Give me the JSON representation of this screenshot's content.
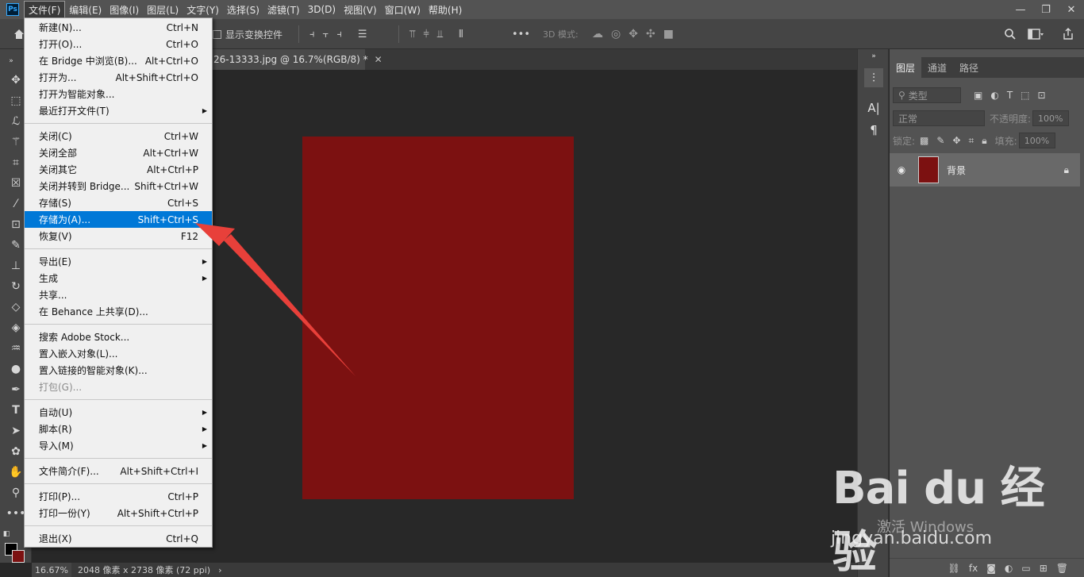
{
  "menubar": {
    "items": [
      "文件(F)",
      "编辑(E)",
      "图像(I)",
      "图层(L)",
      "文字(Y)",
      "选择(S)",
      "滤镜(T)",
      "3D(D)",
      "视图(V)",
      "窗口(W)",
      "帮助(H)"
    ],
    "logo": "Ps",
    "window_controls": [
      "—",
      "❐",
      "✕"
    ]
  },
  "options": {
    "show_transform_label": "显示变换控件",
    "mode_3d_label": "3D 模式:",
    "more_label": "•••"
  },
  "document_tab": {
    "title": "26-13333.jpg @ 16.7%(RGB/8) *",
    "close": "✕"
  },
  "file_menu": {
    "groups": [
      [
        {
          "label": "新建(N)...",
          "shortcut": "Ctrl+N"
        },
        {
          "label": "打开(O)...",
          "shortcut": "Ctrl+O"
        },
        {
          "label": "在 Bridge 中浏览(B)...",
          "shortcut": "Alt+Ctrl+O"
        },
        {
          "label": "打开为...",
          "shortcut": "Alt+Shift+Ctrl+O"
        },
        {
          "label": "打开为智能对象...",
          "shortcut": ""
        },
        {
          "label": "最近打开文件(T)",
          "shortcut": "",
          "submenu": true
        }
      ],
      [
        {
          "label": "关闭(C)",
          "shortcut": "Ctrl+W"
        },
        {
          "label": "关闭全部",
          "shortcut": "Alt+Ctrl+W"
        },
        {
          "label": "关闭其它",
          "shortcut": "Alt+Ctrl+P"
        },
        {
          "label": "关闭并转到 Bridge...",
          "shortcut": "Shift+Ctrl+W"
        },
        {
          "label": "存储(S)",
          "shortcut": "Ctrl+S"
        },
        {
          "label": "存储为(A)...",
          "shortcut": "Shift+Ctrl+S",
          "highlighted": true
        },
        {
          "label": "恢复(V)",
          "shortcut": "F12"
        }
      ],
      [
        {
          "label": "导出(E)",
          "shortcut": "",
          "submenu": true
        },
        {
          "label": "生成",
          "shortcut": "",
          "submenu": true
        },
        {
          "label": "共享...",
          "shortcut": ""
        },
        {
          "label": "在 Behance 上共享(D)...",
          "shortcut": ""
        }
      ],
      [
        {
          "label": "搜索 Adobe Stock...",
          "shortcut": ""
        },
        {
          "label": "置入嵌入对象(L)...",
          "shortcut": ""
        },
        {
          "label": "置入链接的智能对象(K)...",
          "shortcut": ""
        },
        {
          "label": "打包(G)...",
          "shortcut": "",
          "disabled": true
        }
      ],
      [
        {
          "label": "自动(U)",
          "shortcut": "",
          "submenu": true
        },
        {
          "label": "脚本(R)",
          "shortcut": "",
          "submenu": true
        },
        {
          "label": "导入(M)",
          "shortcut": "",
          "submenu": true
        }
      ],
      [
        {
          "label": "文件简介(F)...",
          "shortcut": "Alt+Shift+Ctrl+I"
        }
      ],
      [
        {
          "label": "打印(P)...",
          "shortcut": "Ctrl+P"
        },
        {
          "label": "打印一份(Y)",
          "shortcut": "Alt+Shift+Ctrl+P"
        }
      ],
      [
        {
          "label": "退出(X)",
          "shortcut": "Ctrl+Q"
        }
      ]
    ]
  },
  "statusbar": {
    "zoom": "16.67%",
    "doc_info": "2048 像素 x 2738 像素 (72 ppi)",
    "arrow": "›"
  },
  "layers_panel": {
    "tabs": [
      "图层",
      "通道",
      "路径"
    ],
    "filter_placeholder": "类型",
    "blend_mode": "正常",
    "opacity_label": "不透明度:",
    "opacity_value": "100%",
    "lock_label": "锁定:",
    "fill_label": "填充:",
    "fill_value": "100%",
    "layer_name": "背景",
    "footer_icons": [
      "⛓",
      "fx",
      "◙",
      "◐",
      "▭",
      "⊞",
      "🗑"
    ]
  },
  "watermark": {
    "brand": "Bai du 经验",
    "activate": "激活 Windows",
    "url": "jingyan.baidu.com"
  },
  "colors": {
    "document_fill": "#7c1111",
    "highlight": "#0078d7",
    "arrow": "#e8403a"
  }
}
